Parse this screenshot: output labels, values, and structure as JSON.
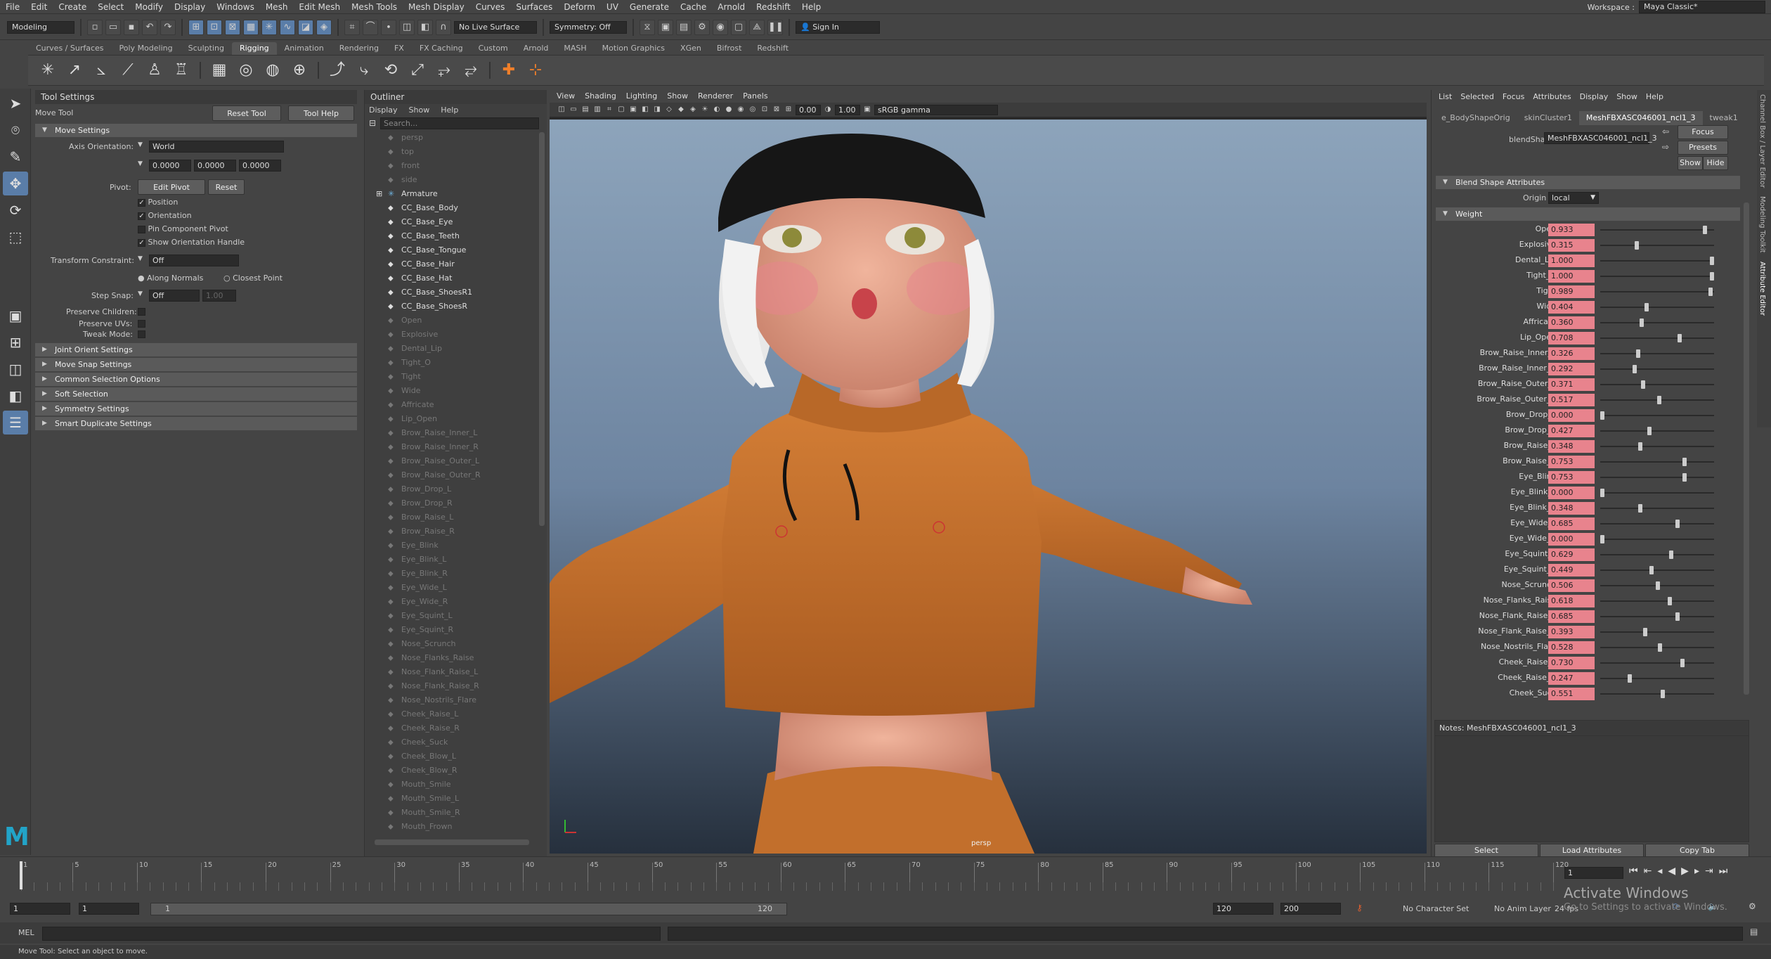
{
  "menubar": {
    "items": [
      "File",
      "Edit",
      "Create",
      "Select",
      "Modify",
      "Display",
      "Windows",
      "Mesh",
      "Edit Mesh",
      "Mesh Tools",
      "Mesh Display",
      "Curves",
      "Surfaces",
      "Deform",
      "UV",
      "Generate",
      "Cache",
      "Arnold",
      "Redshift",
      "Help"
    ],
    "workspace_label": "Workspace :",
    "workspace_value": "Maya Classic*"
  },
  "statusline": {
    "mode": "Modeling",
    "live_surface": "No Live Surface",
    "symmetry": "Symmetry: Off",
    "sign_in": "Sign In"
  },
  "shelf": {
    "tabs": [
      "Curves / Surfaces",
      "Poly Modeling",
      "Sculpting",
      "Rigging",
      "Animation",
      "Rendering",
      "FX",
      "FX Caching",
      "Custom",
      "Arnold",
      "MASH",
      "Motion Graphics",
      "XGen",
      "Bifrost",
      "Redshift"
    ],
    "active_tab": "Rigging"
  },
  "tool_settings": {
    "panel_title": "Tool Settings",
    "tool_name": "Move Tool",
    "reset_tool": "Reset Tool",
    "tool_help": "Tool Help",
    "move_settings": "Move Settings",
    "axis_orientation_label": "Axis Orientation:",
    "axis_orientation_value": "World",
    "xyz": [
      "0.0000",
      "0.0000",
      "0.0000"
    ],
    "pivot_label": "Pivot:",
    "edit_pivot": "Edit Pivot",
    "reset": "Reset",
    "checks": [
      "Position",
      "Orientation",
      "Pin Component Pivot",
      "Show Orientation Handle"
    ],
    "transform_constraint_label": "Transform Constraint:",
    "transform_constraint_value": "Off",
    "along_normals": "Along Normals",
    "closest_point": "Closest Point",
    "step_snap_label": "Step Snap:",
    "step_snap_value": "Off",
    "step_snap_num": "1.00",
    "preserve_children": "Preserve Children:",
    "preserve_uvs": "Preserve UVs:",
    "tweak_mode": "Tweak Mode:",
    "sections": [
      "Joint Orient Settings",
      "Move Snap Settings",
      "Common Selection Options",
      "Soft Selection",
      "Symmetry Settings",
      "Smart Duplicate Settings"
    ]
  },
  "outliner": {
    "title": "Outliner",
    "menu": [
      "Display",
      "Show",
      "Help"
    ],
    "search_placeholder": "Search...",
    "items": [
      {
        "name": "persp",
        "dim": true
      },
      {
        "name": "top",
        "dim": true
      },
      {
        "name": "front",
        "dim": true
      },
      {
        "name": "side",
        "dim": true
      },
      {
        "name": "Armature",
        "dim": false
      },
      {
        "name": "CC_Base_Body",
        "dim": false
      },
      {
        "name": "CC_Base_Eye",
        "dim": false
      },
      {
        "name": "CC_Base_Teeth",
        "dim": false
      },
      {
        "name": "CC_Base_Tongue",
        "dim": false
      },
      {
        "name": "CC_Base_Hair",
        "dim": false
      },
      {
        "name": "CC_Base_Hat",
        "dim": false
      },
      {
        "name": "CC_Base_ShoesR1",
        "dim": false
      },
      {
        "name": "CC_Base_ShoesR",
        "dim": false
      },
      {
        "name": "Open",
        "dim": true
      },
      {
        "name": "Explosive",
        "dim": true
      },
      {
        "name": "Dental_Lip",
        "dim": true
      },
      {
        "name": "Tight_O",
        "dim": true
      },
      {
        "name": "Tight",
        "dim": true
      },
      {
        "name": "Wide",
        "dim": true
      },
      {
        "name": "Affricate",
        "dim": true
      },
      {
        "name": "Lip_Open",
        "dim": true
      },
      {
        "name": "Brow_Raise_Inner_L",
        "dim": true
      },
      {
        "name": "Brow_Raise_Inner_R",
        "dim": true
      },
      {
        "name": "Brow_Raise_Outer_L",
        "dim": true
      },
      {
        "name": "Brow_Raise_Outer_R",
        "dim": true
      },
      {
        "name": "Brow_Drop_L",
        "dim": true
      },
      {
        "name": "Brow_Drop_R",
        "dim": true
      },
      {
        "name": "Brow_Raise_L",
        "dim": true
      },
      {
        "name": "Brow_Raise_R",
        "dim": true
      },
      {
        "name": "Eye_Blink",
        "dim": true
      },
      {
        "name": "Eye_Blink_L",
        "dim": true
      },
      {
        "name": "Eye_Blink_R",
        "dim": true
      },
      {
        "name": "Eye_Wide_L",
        "dim": true
      },
      {
        "name": "Eye_Wide_R",
        "dim": true
      },
      {
        "name": "Eye_Squint_L",
        "dim": true
      },
      {
        "name": "Eye_Squint_R",
        "dim": true
      },
      {
        "name": "Nose_Scrunch",
        "dim": true
      },
      {
        "name": "Nose_Flanks_Raise",
        "dim": true
      },
      {
        "name": "Nose_Flank_Raise_L",
        "dim": true
      },
      {
        "name": "Nose_Flank_Raise_R",
        "dim": true
      },
      {
        "name": "Nose_Nostrils_Flare",
        "dim": true
      },
      {
        "name": "Cheek_Raise_L",
        "dim": true
      },
      {
        "name": "Cheek_Raise_R",
        "dim": true
      },
      {
        "name": "Cheek_Suck",
        "dim": true
      },
      {
        "name": "Cheek_Blow_L",
        "dim": true
      },
      {
        "name": "Cheek_Blow_R",
        "dim": true
      },
      {
        "name": "Mouth_Smile",
        "dim": true
      },
      {
        "name": "Mouth_Smile_L",
        "dim": true
      },
      {
        "name": "Mouth_Smile_R",
        "dim": true
      },
      {
        "name": "Mouth_Frown",
        "dim": true
      }
    ]
  },
  "viewport": {
    "menu": [
      "View",
      "Shading",
      "Lighting",
      "Show",
      "Renderer",
      "Panels"
    ],
    "exposure": "0.00",
    "gamma": "1.00",
    "color_space": "sRGB gamma",
    "camera_label": "persp"
  },
  "attribute_editor": {
    "menu": [
      "List",
      "Selected",
      "Focus",
      "Attributes",
      "Display",
      "Show",
      "Help"
    ],
    "tabs": [
      "e_BodyShapeOrig",
      "skinCluster1",
      "MeshFBXASC046001_ncl1_3",
      "tweak1"
    ],
    "active_tab": "MeshFBXASC046001_ncl1_3",
    "blendshape_label": "blendShape:",
    "blendshape_value": "MeshFBXASC046001_ncl1_3",
    "focus": "Focus",
    "presets": "Presets",
    "show": "Show",
    "hide": "Hide",
    "section": "Blend Shape Attributes",
    "origin_label": "Origin",
    "origin_value": "local",
    "weight_section": "Weight",
    "weights": [
      {
        "name": "Open",
        "value": "0.933"
      },
      {
        "name": "Explosive",
        "value": "0.315"
      },
      {
        "name": "Dental_Lip",
        "value": "1.000"
      },
      {
        "name": "Tight_O",
        "value": "1.000"
      },
      {
        "name": "Tight",
        "value": "0.989"
      },
      {
        "name": "Wide",
        "value": "0.404"
      },
      {
        "name": "Affricate",
        "value": "0.360"
      },
      {
        "name": "Lip_Open",
        "value": "0.708"
      },
      {
        "name": "Brow_Raise_Inner_L",
        "value": "0.326"
      },
      {
        "name": "Brow_Raise_Inner_R",
        "value": "0.292"
      },
      {
        "name": "Brow_Raise_Outer_L",
        "value": "0.371"
      },
      {
        "name": "Brow_Raise_Outer_R",
        "value": "0.517"
      },
      {
        "name": "Brow_Drop_L",
        "value": "0.000"
      },
      {
        "name": "Brow_Drop_R",
        "value": "0.427"
      },
      {
        "name": "Brow_Raise_L",
        "value": "0.348"
      },
      {
        "name": "Brow_Raise_R",
        "value": "0.753"
      },
      {
        "name": "Eye_Blink",
        "value": "0.753"
      },
      {
        "name": "Eye_Blink_L",
        "value": "0.000"
      },
      {
        "name": "Eye_Blink_R",
        "value": "0.348"
      },
      {
        "name": "Eye_Wide_L",
        "value": "0.685"
      },
      {
        "name": "Eye_Wide_R",
        "value": "0.000"
      },
      {
        "name": "Eye_Squint_L",
        "value": "0.629"
      },
      {
        "name": "Eye_Squint_R",
        "value": "0.449"
      },
      {
        "name": "Nose_Scrunch",
        "value": "0.506"
      },
      {
        "name": "Nose_Flanks_Raise",
        "value": "0.618"
      },
      {
        "name": "Nose_Flank_Raise_L",
        "value": "0.685"
      },
      {
        "name": "Nose_Flank_Raise_R",
        "value": "0.393"
      },
      {
        "name": "Nose_Nostrils_Flare",
        "value": "0.528"
      },
      {
        "name": "Cheek_Raise_L",
        "value": "0.730"
      },
      {
        "name": "Cheek_Raise_R",
        "value": "0.247"
      },
      {
        "name": "Cheek_Suck",
        "value": "0.551"
      }
    ],
    "notes_label": "Notes:  MeshFBXASC046001_ncl1_3",
    "bottom_buttons": [
      "Select",
      "Load Attributes",
      "Copy Tab"
    ]
  },
  "side_tabs": [
    "Channel Box / Layer Editor",
    "Modeling Toolkit",
    "Attribute Editor"
  ],
  "timeline": {
    "ticks": [
      "1",
      "5",
      "10",
      "15",
      "20",
      "25",
      "30",
      "35",
      "40",
      "45",
      "50",
      "55",
      "60",
      "65",
      "70",
      "75",
      "80",
      "85",
      "90",
      "95",
      "100",
      "105",
      "110",
      "115",
      "120"
    ],
    "current_frame": "1"
  },
  "range": {
    "start": "1",
    "start2": "1",
    "slider_start": "1",
    "slider_end": "120",
    "end": "120",
    "end2": "200",
    "character_set": "No Character Set",
    "anim_layer": "No Anim Layer",
    "fps": "24 fps"
  },
  "activate": {
    "title": "Activate Windows",
    "subtitle": "Go to Settings to activate Windows."
  },
  "cmd": {
    "label": "MEL"
  },
  "help_line": "Move Tool: Select an object to move.",
  "colors": {
    "accent": "#5a7da8",
    "weight_field": "#e8838d",
    "hoodie": "#c9752f",
    "maya_logo": "#22a4c8"
  }
}
